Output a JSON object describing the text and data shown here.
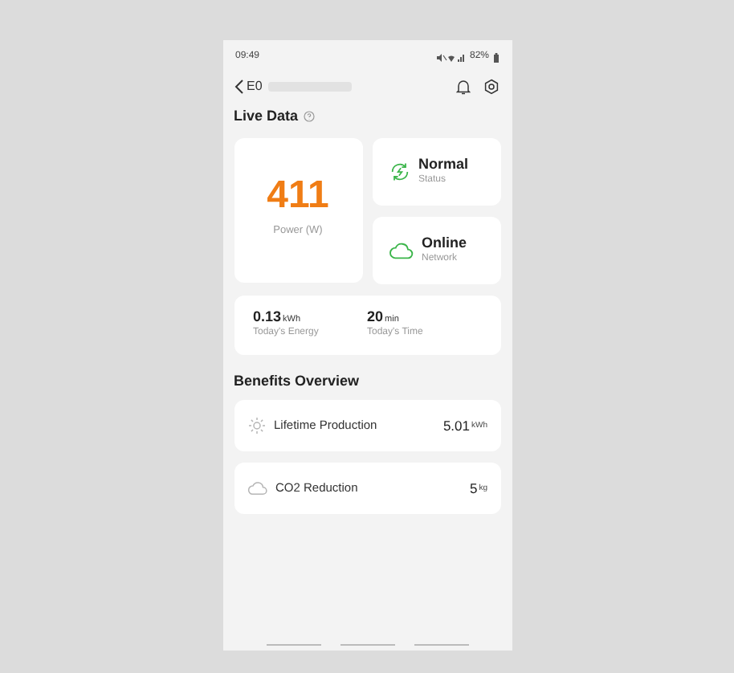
{
  "status_bar": {
    "time": "09:49",
    "battery": "82%"
  },
  "header": {
    "title": "E0"
  },
  "live_data": {
    "title": "Live Data",
    "power": {
      "value": "411",
      "label": "Power (W)"
    },
    "status": {
      "value": "Normal",
      "label": "Status"
    },
    "network": {
      "value": "Online",
      "label": "Network"
    },
    "today": [
      {
        "value": "0.13",
        "unit": "kWh",
        "label": "Today's Energy"
      },
      {
        "value": "20",
        "unit": "min",
        "label": "Today's Time"
      }
    ]
  },
  "benefits": {
    "title": "Benefits Overview",
    "items": [
      {
        "kind": "sun",
        "label": "Lifetime Production",
        "value": "5.01",
        "unit": "kWh"
      },
      {
        "kind": "cloud",
        "label": "CO2 Reduction",
        "value": "5",
        "unit": "kg"
      }
    ]
  }
}
